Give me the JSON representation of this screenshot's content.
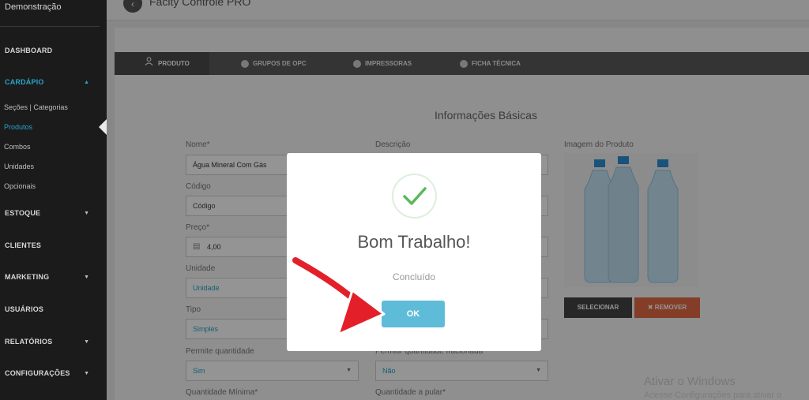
{
  "sidebar": {
    "top_label": "Demonstração",
    "sections": [
      {
        "label": "DASHBOARD"
      },
      {
        "label": "CARDÁPIO"
      },
      {
        "label": "ESTOQUE"
      },
      {
        "label": "CLIENTES"
      },
      {
        "label": "MARKETING"
      },
      {
        "label": "USUÁRIOS"
      },
      {
        "label": "RELATÓRIOS"
      },
      {
        "label": "CONFIGURAÇÕES"
      }
    ],
    "submenu": [
      {
        "label": "Seções | Categorias"
      },
      {
        "label": "Produtos"
      },
      {
        "label": "Combos"
      },
      {
        "label": "Unidades"
      },
      {
        "label": "Opcionais"
      }
    ]
  },
  "header": {
    "title": "Facity Controle PRO"
  },
  "tabs": [
    {
      "label": "PRODUTO"
    },
    {
      "label": "GRUPOS DE OPC"
    },
    {
      "label": "IMPRESSORAS"
    },
    {
      "label": "FICHA TÉCNICA"
    }
  ],
  "form": {
    "section_title": "Informações Básicas",
    "nome_label": "Nome*",
    "nome_value": "Água Mineral Com Gás",
    "codigo_label": "Código",
    "codigo_value": "Código",
    "preco_label": "Preço*",
    "preco_value": "4,00",
    "unidade_label": "Unidade",
    "unidade_value": "Unidade",
    "tipo_label": "Tipo",
    "tipo_value": "Simples",
    "permite_qtd_label": "Permite quantidade",
    "permite_qtd_value": "Sim",
    "qtd_min_label": "Quantidade Mínima*",
    "descricao_label": "Descrição",
    "fracionada_label": "Permitir quantidade fracionada",
    "fracionada_value": "Não",
    "qtd_pular_label": "Quantidade a pular*",
    "imagem_label": "Imagem do Produto",
    "selecionar_label": "SELECIONAR",
    "remover_label": "✖ REMOVER"
  },
  "modal": {
    "title": "Bom Trabalho!",
    "text": "Concluído",
    "ok_label": "OK"
  },
  "watermark": {
    "line1": "Ativar o Windows",
    "line2": "Acesse Configurações para ativar o Windows."
  },
  "colors": {
    "accent": "#2aa3c8",
    "ok_button": "#5fbcd8",
    "remove_button": "#e46a44",
    "arrow": "#e3202a"
  }
}
